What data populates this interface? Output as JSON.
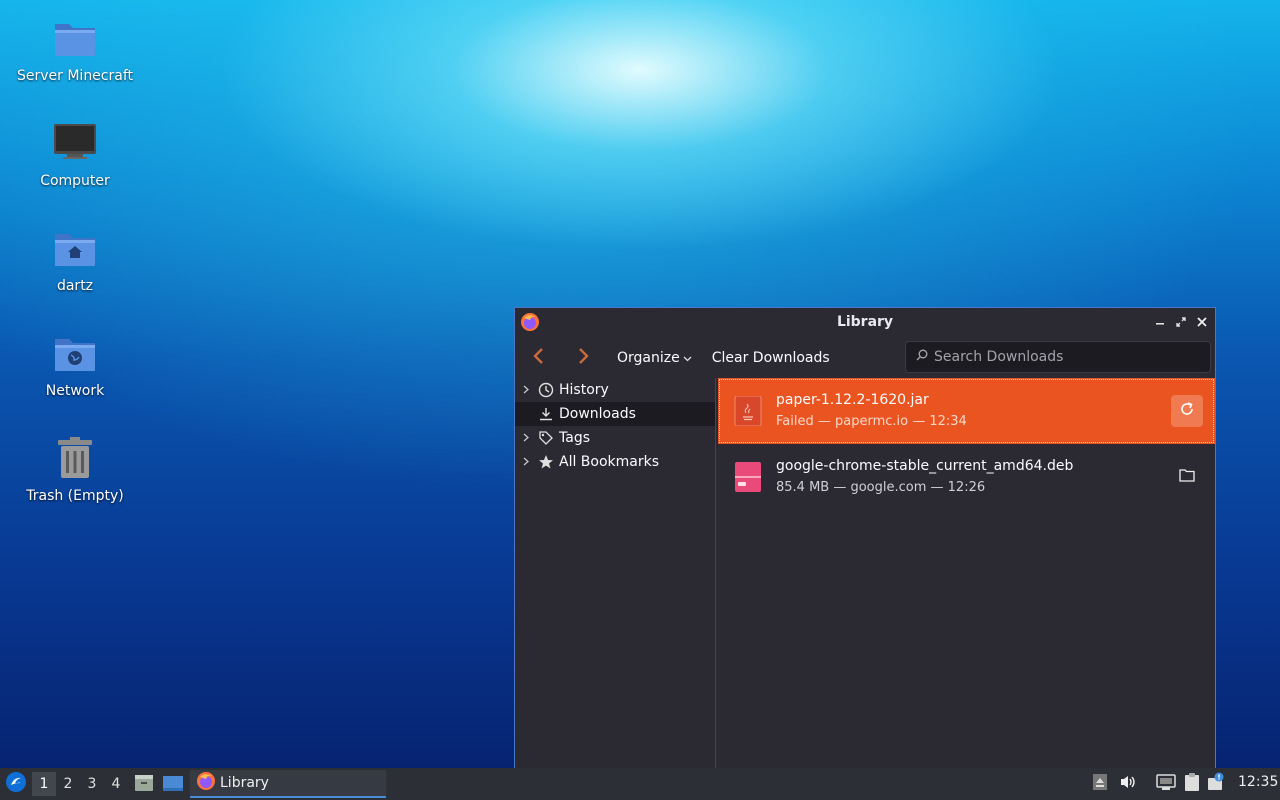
{
  "desktop": {
    "icons": [
      {
        "label": "Server Minecraft",
        "icon": "folder-icon"
      },
      {
        "label": "Computer",
        "icon": "computer-icon"
      },
      {
        "label": "dartz",
        "icon": "home-folder-icon"
      },
      {
        "label": "Network",
        "icon": "network-folder-icon"
      },
      {
        "label": "Trash (Empty)",
        "icon": "trash-icon"
      }
    ]
  },
  "window": {
    "title": "Library",
    "app_icon": "firefox-icon",
    "controls": {
      "minimize": "minimize-icon",
      "maximize": "maximize-icon",
      "close": "close-icon"
    },
    "toolbar": {
      "back": "back-arrow-icon",
      "forward": "forward-arrow-icon",
      "organize_label": "Organize",
      "clear_label": "Clear Downloads",
      "search_placeholder": "Search Downloads"
    },
    "sidebar": [
      {
        "label": "History",
        "icon": "clock-icon",
        "expandable": true
      },
      {
        "label": "Downloads",
        "icon": "download-icon",
        "expandable": false,
        "selected": true
      },
      {
        "label": "Tags",
        "icon": "tag-icon",
        "expandable": true
      },
      {
        "label": "All Bookmarks",
        "icon": "star-icon",
        "expandable": true
      }
    ],
    "downloads": [
      {
        "name": "paper-1.12.2-1620.jar",
        "meta": "Failed — papermc.io — 12:34",
        "icon": "java-file-icon",
        "action": "retry-icon",
        "selected": true
      },
      {
        "name": "google-chrome-stable_current_amd64.deb",
        "meta": "85.4 MB — google.com — 12:26",
        "icon": "deb-package-icon",
        "action": "open-folder-icon",
        "selected": false
      }
    ]
  },
  "taskbar": {
    "workspaces": [
      "1",
      "2",
      "3",
      "4"
    ],
    "active_workspace": "1",
    "task_label": "Library",
    "clock": "12:35"
  },
  "colors": {
    "selection": "#e95420",
    "window_bg": "#2b2a33",
    "taskbar_bg": "#2c2f35",
    "window_border": "#4a78c6"
  }
}
